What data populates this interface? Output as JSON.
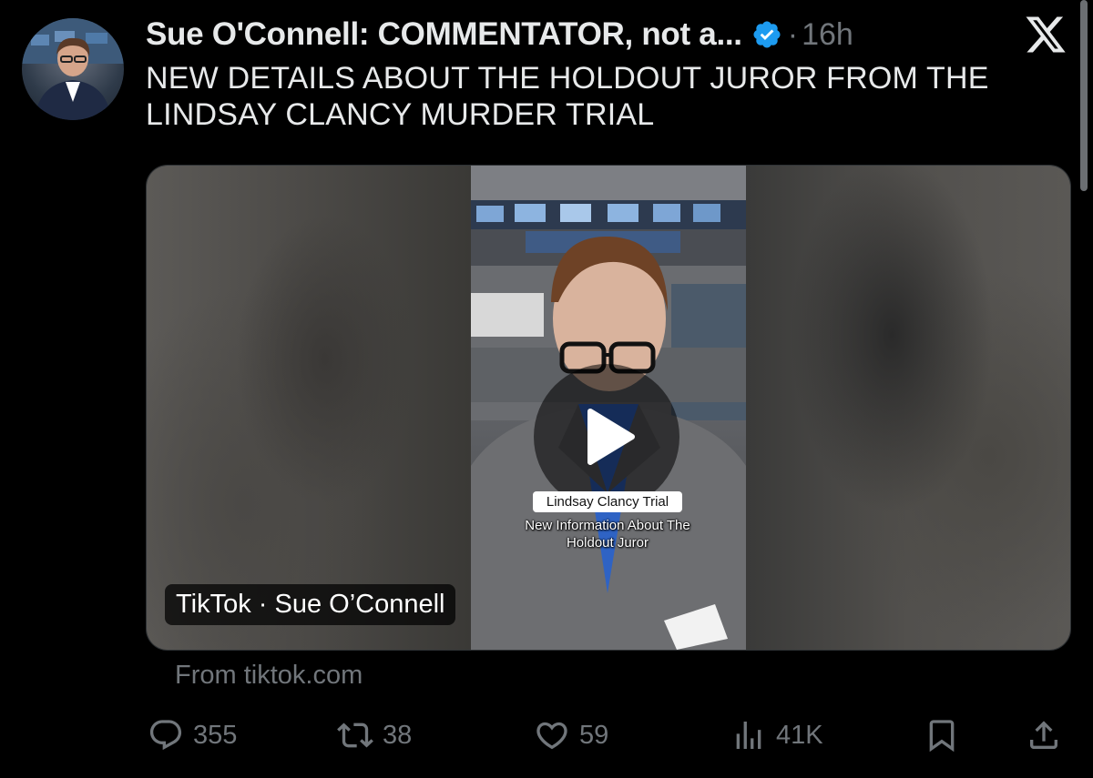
{
  "tweet": {
    "author_name": "Sue O'Connell: COMMENTATOR, not a...",
    "separator": "·",
    "timestamp": "16h",
    "text": "NEW DETAILS ABOUT THE HOLDOUT JUROR FROM THE LINDSAY CLANCY MURDER TRIAL",
    "verified_icon": "verified-badge-icon",
    "platform_icon": "x-logo-icon"
  },
  "media": {
    "caption_title": "Lindsay Clancy Trial",
    "caption_subtitle": "New Information About The Holdout Juror",
    "source_label": "TikTok · Sue O’Connell",
    "from_label": "From tiktok.com"
  },
  "actions": {
    "replies": "355",
    "reposts": "38",
    "likes": "59",
    "views": "41K"
  },
  "colors": {
    "background": "#000000",
    "text": "#e7e9ea",
    "muted": "#71767b",
    "verified": "#1d9bf0"
  }
}
